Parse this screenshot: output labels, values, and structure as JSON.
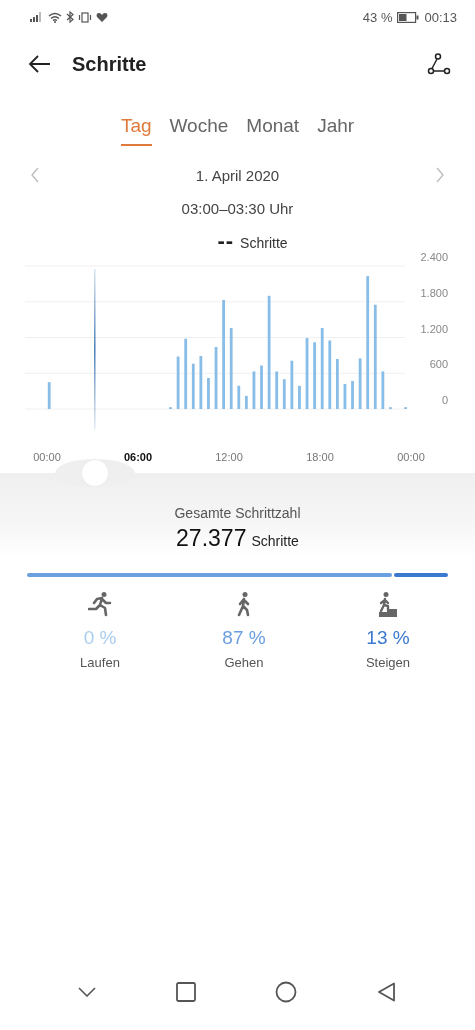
{
  "status_bar": {
    "battery_text": "43 %",
    "time": "00:13"
  },
  "header": {
    "title": "Schritte"
  },
  "tabs": [
    {
      "label": "Tag",
      "selected": true
    },
    {
      "label": "Woche",
      "selected": false
    },
    {
      "label": "Monat",
      "selected": false
    },
    {
      "label": "Jahr",
      "selected": false
    }
  ],
  "date": "1. April 2020",
  "period": "03:00–03:30 Uhr",
  "selected_value": "--",
  "chart_data": {
    "type": "bar",
    "x": [
      0,
      8,
      8.5,
      9,
      9.5,
      10,
      10.5,
      11,
      11.5,
      12,
      12.5,
      13,
      13.5,
      14,
      14.5,
      15,
      15.5,
      16,
      16.5,
      17,
      17.5,
      18,
      18.5,
      19,
      19.5,
      20,
      20.5,
      21,
      21.5,
      22,
      22.5,
      23.5
    ],
    "series": [
      {
        "name": "Schritte",
        "color": "#88bde8",
        "values": [
          450,
          30,
          880,
          1180,
          760,
          890,
          520,
          1040,
          1830,
          1360,
          390,
          220,
          630,
          730,
          1900,
          630,
          500,
          810,
          390,
          1190,
          1120,
          1360,
          1150,
          840,
          420,
          470,
          850,
          2230,
          1750,
          630,
          30,
          30
        ]
      }
    ],
    "xlim": [
      0,
      24
    ],
    "ylim": [
      0,
      2400
    ],
    "grid": true,
    "ref_lines": [
      {
        "axis": "x",
        "value": 3.15
      }
    ],
    "xticks": [
      {
        "value": 0,
        "label": "00:00"
      },
      {
        "value": 6,
        "label": "06:00"
      },
      {
        "value": 12,
        "label": "12:00"
      },
      {
        "value": 18,
        "label": "18:00"
      },
      {
        "value": 24,
        "label": "00:00"
      }
    ],
    "yticks": [
      {
        "value": 0,
        "label": "0"
      },
      {
        "value": 600,
        "label": "600"
      },
      {
        "value": 1200,
        "label": "1.200"
      },
      {
        "value": 1800,
        "label": "1.800"
      },
      {
        "value": 2400,
        "label": "2.400"
      }
    ]
  },
  "total": {
    "label": "Gesamte Schrittzahl",
    "value": "27.377",
    "unit": "Schritte"
  },
  "activities": [
    {
      "kind": "run",
      "percent": "0 %",
      "label": "Laufen",
      "color": "#a9cdef"
    },
    {
      "kind": "walk",
      "percent": "87 %",
      "label": "Gehen",
      "color": "#6a9fe0"
    },
    {
      "kind": "climb",
      "percent": "13 %",
      "label": "Steigen",
      "color": "#3b78d0"
    }
  ]
}
